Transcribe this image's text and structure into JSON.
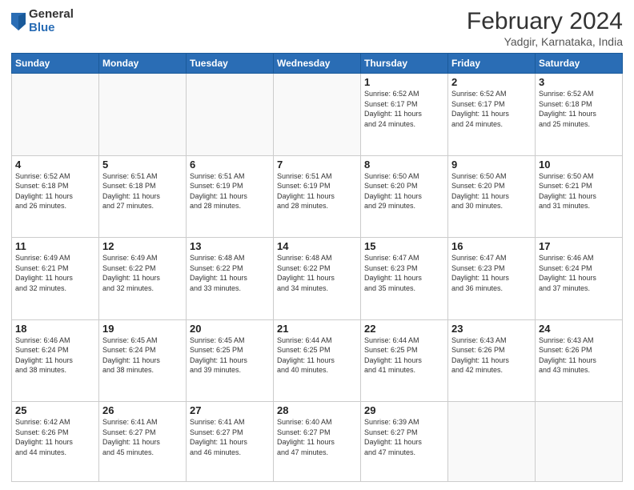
{
  "header": {
    "logo_general": "General",
    "logo_blue": "Blue",
    "month_title": "February 2024",
    "location": "Yadgir, Karnataka, India"
  },
  "days_of_week": [
    "Sunday",
    "Monday",
    "Tuesday",
    "Wednesday",
    "Thursday",
    "Friday",
    "Saturday"
  ],
  "weeks": [
    [
      {
        "day": "",
        "info": ""
      },
      {
        "day": "",
        "info": ""
      },
      {
        "day": "",
        "info": ""
      },
      {
        "day": "",
        "info": ""
      },
      {
        "day": "1",
        "info": "Sunrise: 6:52 AM\nSunset: 6:17 PM\nDaylight: 11 hours\nand 24 minutes."
      },
      {
        "day": "2",
        "info": "Sunrise: 6:52 AM\nSunset: 6:17 PM\nDaylight: 11 hours\nand 24 minutes."
      },
      {
        "day": "3",
        "info": "Sunrise: 6:52 AM\nSunset: 6:18 PM\nDaylight: 11 hours\nand 25 minutes."
      }
    ],
    [
      {
        "day": "4",
        "info": "Sunrise: 6:52 AM\nSunset: 6:18 PM\nDaylight: 11 hours\nand 26 minutes."
      },
      {
        "day": "5",
        "info": "Sunrise: 6:51 AM\nSunset: 6:18 PM\nDaylight: 11 hours\nand 27 minutes."
      },
      {
        "day": "6",
        "info": "Sunrise: 6:51 AM\nSunset: 6:19 PM\nDaylight: 11 hours\nand 28 minutes."
      },
      {
        "day": "7",
        "info": "Sunrise: 6:51 AM\nSunset: 6:19 PM\nDaylight: 11 hours\nand 28 minutes."
      },
      {
        "day": "8",
        "info": "Sunrise: 6:50 AM\nSunset: 6:20 PM\nDaylight: 11 hours\nand 29 minutes."
      },
      {
        "day": "9",
        "info": "Sunrise: 6:50 AM\nSunset: 6:20 PM\nDaylight: 11 hours\nand 30 minutes."
      },
      {
        "day": "10",
        "info": "Sunrise: 6:50 AM\nSunset: 6:21 PM\nDaylight: 11 hours\nand 31 minutes."
      }
    ],
    [
      {
        "day": "11",
        "info": "Sunrise: 6:49 AM\nSunset: 6:21 PM\nDaylight: 11 hours\nand 32 minutes."
      },
      {
        "day": "12",
        "info": "Sunrise: 6:49 AM\nSunset: 6:22 PM\nDaylight: 11 hours\nand 32 minutes."
      },
      {
        "day": "13",
        "info": "Sunrise: 6:48 AM\nSunset: 6:22 PM\nDaylight: 11 hours\nand 33 minutes."
      },
      {
        "day": "14",
        "info": "Sunrise: 6:48 AM\nSunset: 6:22 PM\nDaylight: 11 hours\nand 34 minutes."
      },
      {
        "day": "15",
        "info": "Sunrise: 6:47 AM\nSunset: 6:23 PM\nDaylight: 11 hours\nand 35 minutes."
      },
      {
        "day": "16",
        "info": "Sunrise: 6:47 AM\nSunset: 6:23 PM\nDaylight: 11 hours\nand 36 minutes."
      },
      {
        "day": "17",
        "info": "Sunrise: 6:46 AM\nSunset: 6:24 PM\nDaylight: 11 hours\nand 37 minutes."
      }
    ],
    [
      {
        "day": "18",
        "info": "Sunrise: 6:46 AM\nSunset: 6:24 PM\nDaylight: 11 hours\nand 38 minutes."
      },
      {
        "day": "19",
        "info": "Sunrise: 6:45 AM\nSunset: 6:24 PM\nDaylight: 11 hours\nand 38 minutes."
      },
      {
        "day": "20",
        "info": "Sunrise: 6:45 AM\nSunset: 6:25 PM\nDaylight: 11 hours\nand 39 minutes."
      },
      {
        "day": "21",
        "info": "Sunrise: 6:44 AM\nSunset: 6:25 PM\nDaylight: 11 hours\nand 40 minutes."
      },
      {
        "day": "22",
        "info": "Sunrise: 6:44 AM\nSunset: 6:25 PM\nDaylight: 11 hours\nand 41 minutes."
      },
      {
        "day": "23",
        "info": "Sunrise: 6:43 AM\nSunset: 6:26 PM\nDaylight: 11 hours\nand 42 minutes."
      },
      {
        "day": "24",
        "info": "Sunrise: 6:43 AM\nSunset: 6:26 PM\nDaylight: 11 hours\nand 43 minutes."
      }
    ],
    [
      {
        "day": "25",
        "info": "Sunrise: 6:42 AM\nSunset: 6:26 PM\nDaylight: 11 hours\nand 44 minutes."
      },
      {
        "day": "26",
        "info": "Sunrise: 6:41 AM\nSunset: 6:27 PM\nDaylight: 11 hours\nand 45 minutes."
      },
      {
        "day": "27",
        "info": "Sunrise: 6:41 AM\nSunset: 6:27 PM\nDaylight: 11 hours\nand 46 minutes."
      },
      {
        "day": "28",
        "info": "Sunrise: 6:40 AM\nSunset: 6:27 PM\nDaylight: 11 hours\nand 47 minutes."
      },
      {
        "day": "29",
        "info": "Sunrise: 6:39 AM\nSunset: 6:27 PM\nDaylight: 11 hours\nand 47 minutes."
      },
      {
        "day": "",
        "info": ""
      },
      {
        "day": "",
        "info": ""
      }
    ]
  ]
}
